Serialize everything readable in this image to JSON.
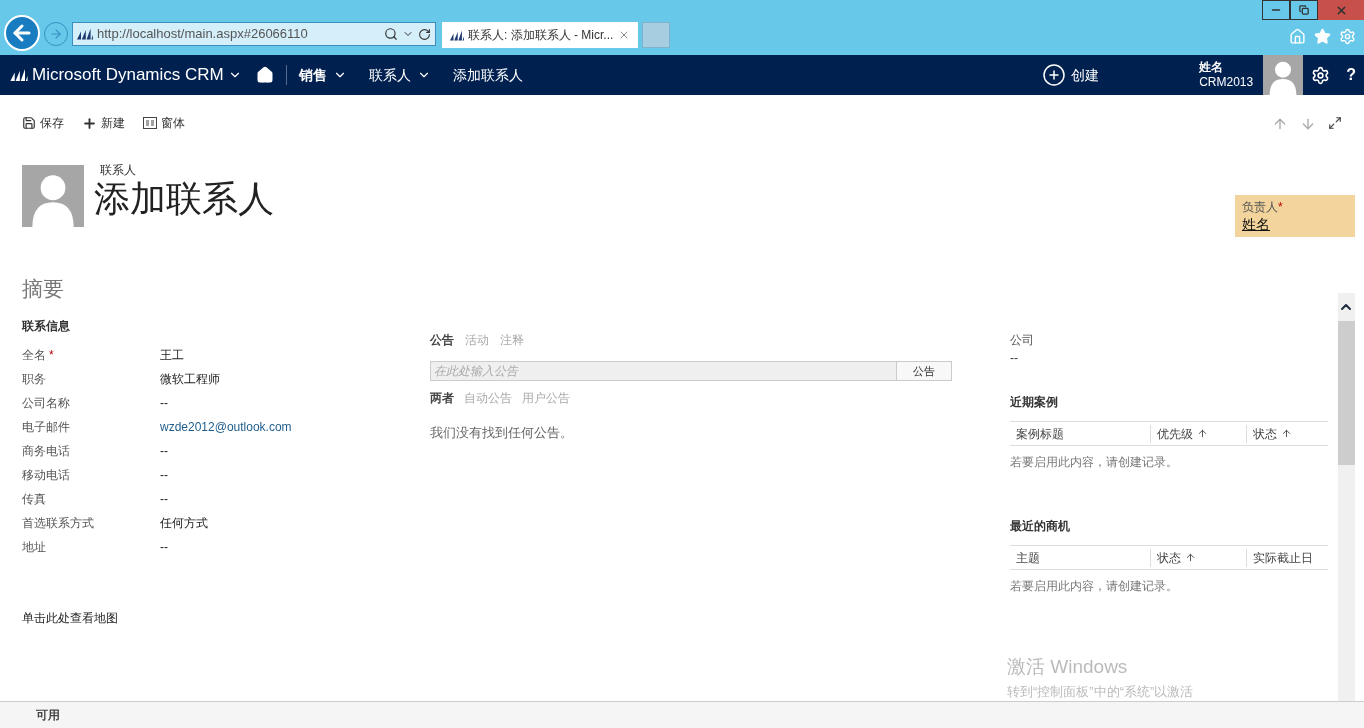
{
  "browser": {
    "address": "http://localhost/main.aspx#26066110",
    "tab_title": "联系人: 添加联系人 - Micr..."
  },
  "nav": {
    "brand": "Microsoft Dynamics CRM",
    "items": [
      {
        "label": "销售",
        "bold": true,
        "dropdown": true
      },
      {
        "label": "联系人",
        "bold": false,
        "dropdown": true
      },
      {
        "label": "添加联系人",
        "bold": false,
        "dropdown": false
      }
    ],
    "create": "创建",
    "user_name": "姓名",
    "org": "CRM2013",
    "help": "?"
  },
  "commands": [
    {
      "kind": "save",
      "label": "保存"
    },
    {
      "kind": "new",
      "label": "新建"
    },
    {
      "kind": "form",
      "label": "窗体"
    }
  ],
  "header": {
    "entity": "联系人",
    "title": "添加联系人",
    "owner_label": "负责人",
    "owner_required": "*",
    "owner_value": "姓名"
  },
  "section_title": "摘要",
  "contact": {
    "heading": "联系信息",
    "fields": [
      {
        "label": "全名",
        "required": true,
        "value": "王工",
        "link": false
      },
      {
        "label": "职务",
        "required": false,
        "value": "微软工程师",
        "link": false
      },
      {
        "label": "公司名称",
        "required": false,
        "value": "--",
        "link": false
      },
      {
        "label": "电子邮件",
        "required": false,
        "value": "wzde2012@outlook.com",
        "link": true
      },
      {
        "label": "商务电话",
        "required": false,
        "value": "--",
        "link": false
      },
      {
        "label": "移动电话",
        "required": false,
        "value": "--",
        "link": false
      },
      {
        "label": "传真",
        "required": false,
        "value": "--",
        "link": false
      },
      {
        "label": "首选联系方式",
        "required": false,
        "value": "任何方式",
        "link": false
      },
      {
        "label": "地址",
        "required": false,
        "value": "--",
        "link": false
      }
    ],
    "required_mark": "*",
    "map_link": "单击此处查看地图"
  },
  "posts": {
    "tabs": [
      {
        "label": "公告",
        "selected": true
      },
      {
        "label": "活动",
        "selected": false
      },
      {
        "label": "注释",
        "selected": false
      }
    ],
    "placeholder": "在此处输入公告",
    "button": "公告",
    "filters": [
      {
        "label": "两者",
        "selected": true
      },
      {
        "label": "自动公告",
        "selected": false
      },
      {
        "label": "用户公告",
        "selected": false
      }
    ],
    "empty": "我们没有找到任何公告。"
  },
  "company": {
    "label": "公司",
    "value": "--"
  },
  "grids": [
    {
      "title": "近期案例",
      "columns": [
        {
          "label": "案例标题",
          "sorted": false
        },
        {
          "label": "优先级",
          "sorted": true
        },
        {
          "label": "状态",
          "sorted": true
        }
      ],
      "empty": "若要启用此内容，请创建记录。"
    },
    {
      "title": "最近的商机",
      "columns": [
        {
          "label": "主题",
          "sorted": false
        },
        {
          "label": "状态",
          "sorted": true
        },
        {
          "label": "实际截止日",
          "sorted": false
        }
      ],
      "empty": "若要启用此内容，请创建记录。"
    }
  ],
  "activation": {
    "title": "激活 Windows",
    "text": "转到“控制面板”中的“系统”以激活"
  },
  "status_bar": "可用"
}
